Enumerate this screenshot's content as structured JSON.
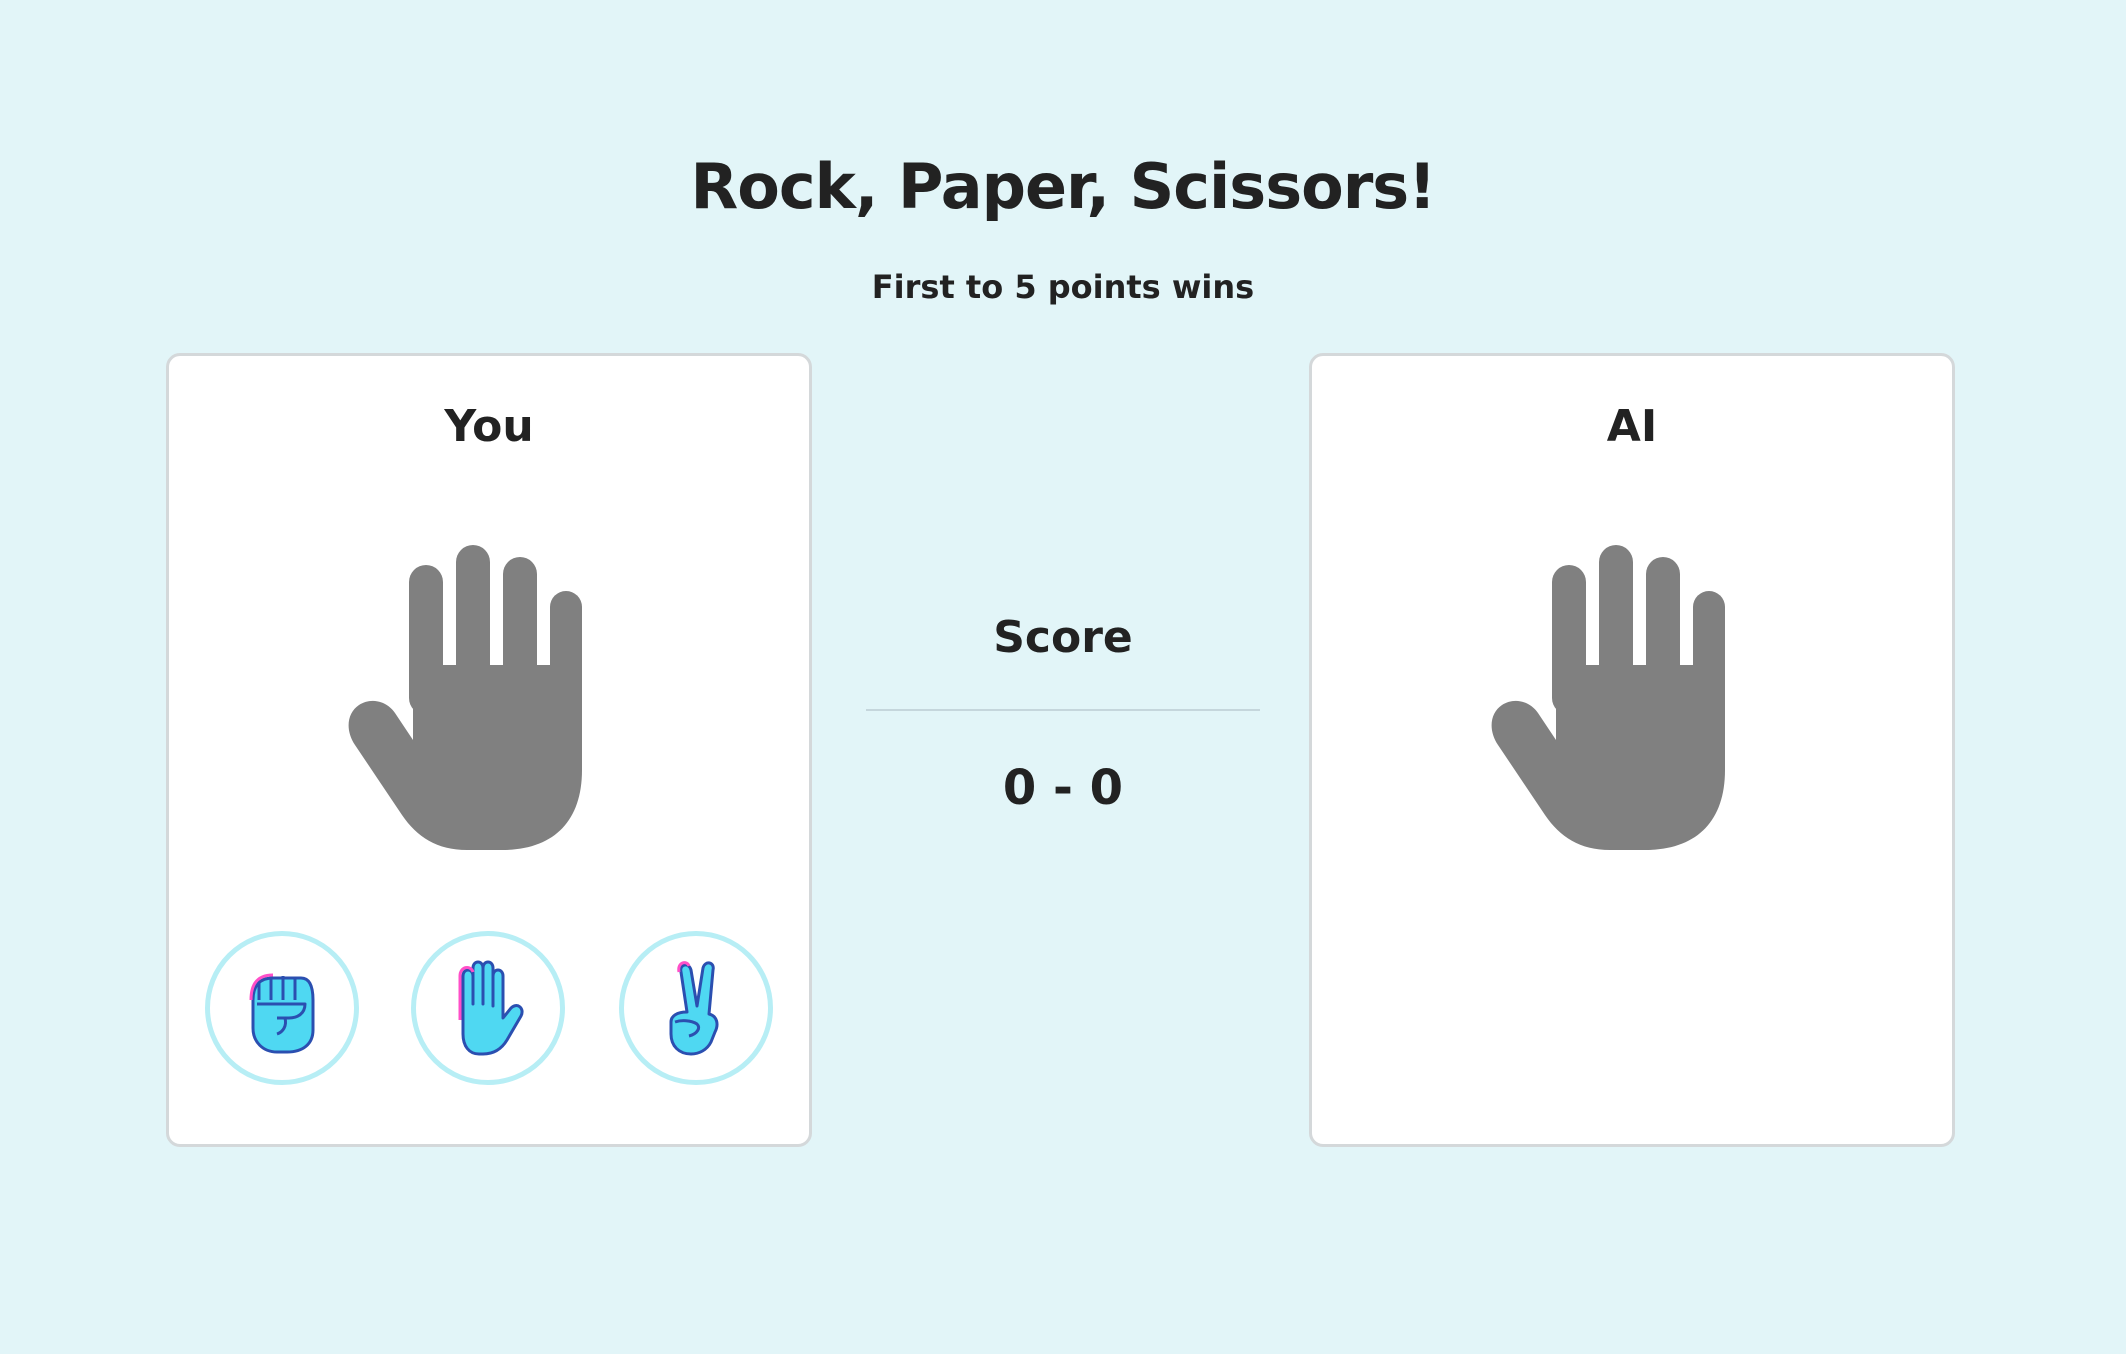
{
  "header": {
    "title": "Rock, Paper, Scissors!",
    "subtitle": "First to 5 points wins"
  },
  "player": {
    "label": "You",
    "current_hand_icon": "raised-hand-icon",
    "choices": [
      {
        "name": "rock",
        "icon": "raised-fist-icon"
      },
      {
        "name": "paper",
        "icon": "raised-hand-icon"
      },
      {
        "name": "scissors",
        "icon": "victory-hand-icon"
      }
    ]
  },
  "ai": {
    "label": "AI",
    "current_hand_icon": "raised-hand-icon"
  },
  "score": {
    "label": "Score",
    "value": "0 - 0"
  },
  "colors": {
    "background": "#e2f5f8",
    "panel_border": "#d4d8da",
    "hand_gray": "#808080",
    "choice_ring": "#b7eef5",
    "emoji_fill": "#4fd8f2",
    "emoji_stroke": "#2b4fb0",
    "emoji_accent": "#ff4fc8"
  }
}
